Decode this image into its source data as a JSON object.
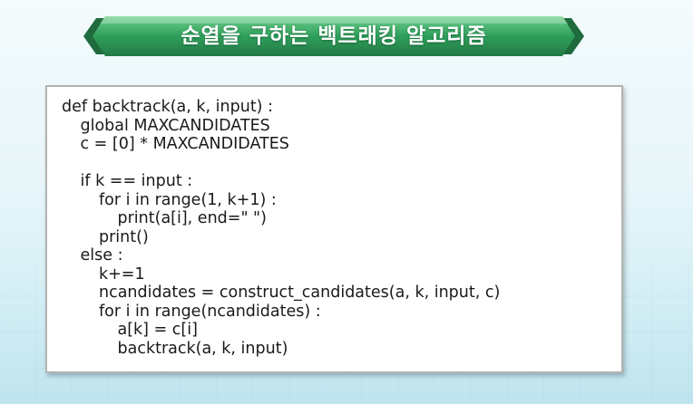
{
  "banner": {
    "title": "순열을 구하는 백트래킹 알고리즘"
  },
  "code": {
    "lines": [
      {
        "indent": 0,
        "text": "def backtrack(a, k, input) :"
      },
      {
        "indent": 1,
        "text": "global MAXCANDIDATES"
      },
      {
        "indent": 1,
        "text": "c = [0] * MAXCANDIDATES"
      },
      {
        "indent": 0,
        "text": ""
      },
      {
        "indent": 1,
        "text": "if k == input :"
      },
      {
        "indent": 2,
        "text": "for i in range(1, k+1) :"
      },
      {
        "indent": 3,
        "text": "print(a[i], end=\" \")"
      },
      {
        "indent": 2,
        "text": "print()"
      },
      {
        "indent": 1,
        "text": "else :"
      },
      {
        "indent": 2,
        "text": "k+=1"
      },
      {
        "indent": 2,
        "text": "ncandidates = construct_candidates(a, k, input, c)"
      },
      {
        "indent": 2,
        "text": "for i in range(ncandidates) :"
      },
      {
        "indent": 3,
        "text": "a[k] = c[i]"
      },
      {
        "indent": 3,
        "text": "backtrack(a, k, input)"
      }
    ]
  },
  "colors": {
    "banner_green": "#2f9f5b",
    "banner_dark": "#1f6b3e"
  }
}
